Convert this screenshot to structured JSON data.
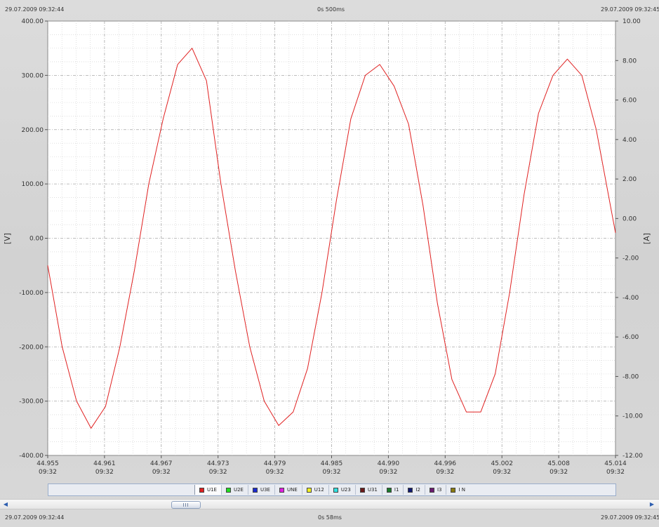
{
  "header": {
    "start_time": "29.07.2009 09:32:44",
    "duration": "0s 500ms",
    "end_time": "29.07.2009 09:32:45"
  },
  "footer": {
    "start_time": "29.07.2009 09:32:44",
    "duration": "0s 58ms",
    "end_time": "29.07.2009 09:32:45"
  },
  "legend": {
    "items": [
      {
        "label": "U1E",
        "color": "#e02020"
      },
      {
        "label": "U2E",
        "color": "#20e020"
      },
      {
        "label": "U3E",
        "color": "#1a2ad0"
      },
      {
        "label": "UNE",
        "color": "#e020e0"
      },
      {
        "label": "U12",
        "color": "#f0f020"
      },
      {
        "label": "U23",
        "color": "#30e0e0"
      },
      {
        "label": "U31",
        "color": "#6a1a1a"
      },
      {
        "label": "I1",
        "color": "#1a7a2a"
      },
      {
        "label": "I2",
        "color": "#101a70"
      },
      {
        "label": "I3",
        "color": "#6a1a70"
      },
      {
        "label": "I N",
        "color": "#8a7a10"
      }
    ]
  },
  "chart_data": {
    "type": "line",
    "ylabel": "[V]",
    "y2label": "[A]",
    "ylim": [
      -400,
      400
    ],
    "y2lim": [
      -12,
      10
    ],
    "xlim": [
      44.955,
      45.014
    ],
    "yticks": [
      "400.00",
      "300.00",
      "200.00",
      "100.00",
      "0.00",
      "-100.00",
      "-200.00",
      "-300.00",
      "-400.00"
    ],
    "y2ticks": [
      "10.00",
      "8.00",
      "6.00",
      "4.00",
      "2.00",
      "0.00",
      "-2.00",
      "-4.00",
      "-6.00",
      "-8.00",
      "-10.00",
      "-12.00"
    ],
    "xticks": [
      {
        "value": "44.955",
        "time": "09:32"
      },
      {
        "value": "44.961",
        "time": "09:32"
      },
      {
        "value": "44.967",
        "time": "09:32"
      },
      {
        "value": "44.973",
        "time": "09:32"
      },
      {
        "value": "44.979",
        "time": "09:32"
      },
      {
        "value": "44.985",
        "time": "09:32"
      },
      {
        "value": "44.990",
        "time": "09:32"
      },
      {
        "value": "44.996",
        "time": "09:32"
      },
      {
        "value": "45.002",
        "time": "09:32"
      },
      {
        "value": "45.008",
        "time": "09:32"
      },
      {
        "value": "45.014",
        "time": "09:32"
      }
    ],
    "grid": true,
    "series": [
      {
        "color": "#e02020",
        "x": [
          44.955,
          44.9565,
          44.958,
          44.9595,
          44.961,
          44.9625,
          44.964,
          44.9655,
          44.967,
          44.9685,
          44.97,
          44.9715,
          44.973,
          44.9745,
          44.976,
          44.9775,
          44.979,
          44.9805,
          44.982,
          44.9835,
          44.985,
          44.9865,
          44.988,
          44.9895,
          44.991,
          44.9925,
          44.994,
          44.9955,
          44.997,
          44.9985,
          45.0,
          45.0015,
          45.003,
          45.0045,
          45.006,
          45.0075,
          45.009,
          45.0105,
          45.012,
          45.014
        ],
        "values": [
          -50,
          -200,
          -300,
          -350,
          -310,
          -200,
          -60,
          100,
          220,
          320,
          350,
          290,
          100,
          -60,
          -200,
          -300,
          -345,
          -320,
          -240,
          -100,
          70,
          220,
          300,
          320,
          280,
          210,
          60,
          -120,
          -260,
          -320,
          -320,
          -250,
          -100,
          80,
          230,
          300,
          330,
          300,
          200,
          10
        ]
      }
    ]
  }
}
